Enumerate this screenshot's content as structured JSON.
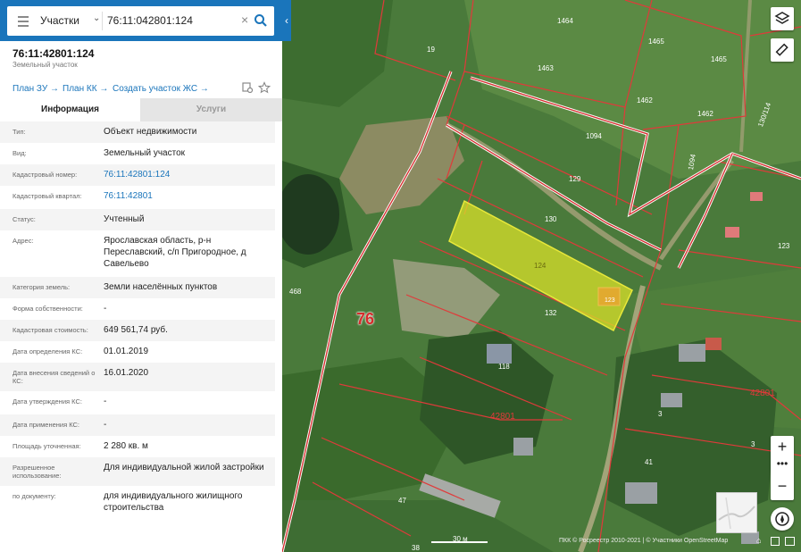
{
  "search": {
    "category": "Участки",
    "query": "76:11:042801:124"
  },
  "header": {
    "cadastral_number": "76:11:42801:124",
    "subtitle": "Земельный участок"
  },
  "actions": {
    "plan_zu": "План ЗУ →",
    "plan_kk": "План КК →",
    "create_zs": "Создать участок ЖС →"
  },
  "tabs": {
    "info": "Информация",
    "services": "Услуги"
  },
  "info": {
    "type": {
      "label": "Тип:",
      "value": "Объект недвижимости"
    },
    "kind": {
      "label": "Вид:",
      "value": "Земельный участок"
    },
    "cad_number": {
      "label": "Кадастровый номер:",
      "value": "76:11:42801:124"
    },
    "cad_quarter": {
      "label": "Кадастровый квартал:",
      "value": "76:11:42801"
    },
    "status": {
      "label": "Статус:",
      "value": "Учтенный"
    },
    "address": {
      "label": "Адрес:",
      "value": "Ярославская область, р-н Переславский, с/п Пригородное, д Савельево"
    },
    "land_category": {
      "label": "Категория земель:",
      "value": "Земли населённых пунктов"
    },
    "ownership": {
      "label": "Форма собственности:",
      "value": "-"
    },
    "cad_value": {
      "label": "Кадастровая стоимость:",
      "value": "649 561,74 руб."
    },
    "date_cs": {
      "label": "Дата определения КС:",
      "value": "01.01.2019"
    },
    "date_entry": {
      "label": "Дата внесения сведений о КС:",
      "value": "16.01.2020"
    },
    "date_approve": {
      "label": "Дата утверждения КС:",
      "value": "-"
    },
    "date_apply": {
      "label": "Дата применения КС:",
      "value": "-"
    },
    "area": {
      "label": "Площадь уточненная:",
      "value": "2 280 кв. м"
    },
    "permitted_use": {
      "label": "Разрешенное использование:",
      "value": "Для индивидуальной жилой застройки"
    },
    "by_document": {
      "label": "по документу:",
      "value": "для индивидуального жилищного строительства"
    }
  },
  "map": {
    "road_number": "76",
    "scale": "30 м",
    "attribution": "ПКК © Росреестр 2010-2021 | © Участники OpenStreetMap",
    "parcel_labels": [
      "1464",
      "1465",
      "1465",
      "1463",
      "1462",
      "1462",
      "19",
      "1094",
      "129",
      "130",
      "124",
      "123",
      "132",
      "118",
      "42801",
      "42801",
      "3",
      "3",
      "41",
      "47",
      "38",
      "468",
      "1094",
      "130/114",
      "123"
    ],
    "colors": {
      "accent": "#1a75bb",
      "parcel_border": "#e03a3a",
      "selected_fill": "#d9e12a",
      "road": "#c0392b"
    }
  }
}
